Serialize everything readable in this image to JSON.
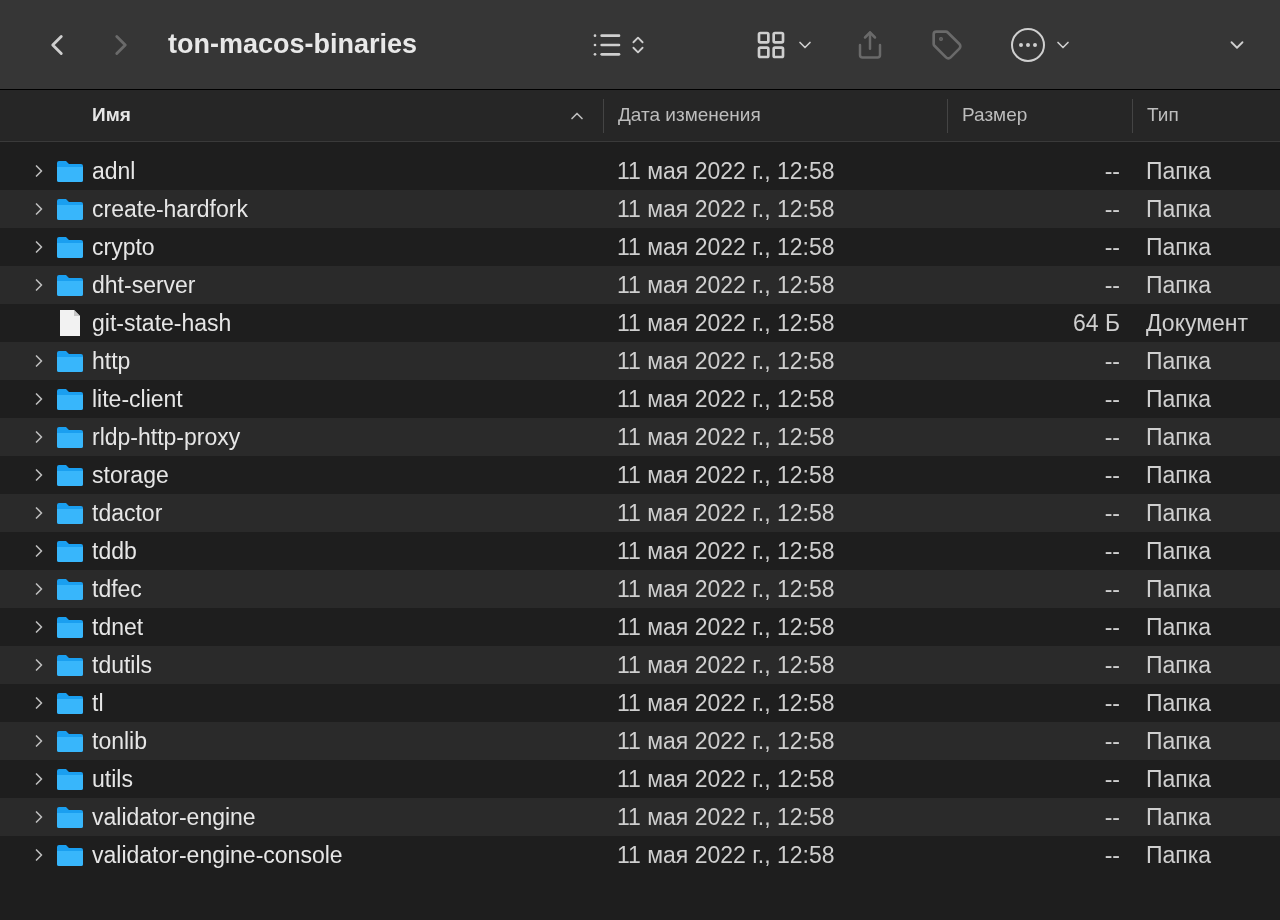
{
  "window": {
    "title": "ton-macos-binaries"
  },
  "columns": [
    {
      "label": "Имя",
      "sorted": true
    },
    {
      "label": "Дата изменения",
      "sorted": false
    },
    {
      "label": "Размер",
      "sorted": false
    },
    {
      "label": "Тип",
      "sorted": false
    }
  ],
  "rows": [
    {
      "kind": "folder",
      "name": "adnl",
      "date": "11 мая 2022 г., 12:58",
      "size": "--",
      "type": "Папка"
    },
    {
      "kind": "folder",
      "name": "create-hardfork",
      "date": "11 мая 2022 г., 12:58",
      "size": "--",
      "type": "Папка"
    },
    {
      "kind": "folder",
      "name": "crypto",
      "date": "11 мая 2022 г., 12:58",
      "size": "--",
      "type": "Папка"
    },
    {
      "kind": "folder",
      "name": "dht-server",
      "date": "11 мая 2022 г., 12:58",
      "size": "--",
      "type": "Папка"
    },
    {
      "kind": "file",
      "name": "git-state-hash",
      "date": "11 мая 2022 г., 12:58",
      "size": "64 Б",
      "type": "Документ"
    },
    {
      "kind": "folder",
      "name": "http",
      "date": "11 мая 2022 г., 12:58",
      "size": "--",
      "type": "Папка"
    },
    {
      "kind": "folder",
      "name": "lite-client",
      "date": "11 мая 2022 г., 12:58",
      "size": "--",
      "type": "Папка"
    },
    {
      "kind": "folder",
      "name": "rldp-http-proxy",
      "date": "11 мая 2022 г., 12:58",
      "size": "--",
      "type": "Папка"
    },
    {
      "kind": "folder",
      "name": "storage",
      "date": "11 мая 2022 г., 12:58",
      "size": "--",
      "type": "Папка"
    },
    {
      "kind": "folder",
      "name": "tdactor",
      "date": "11 мая 2022 г., 12:58",
      "size": "--",
      "type": "Папка"
    },
    {
      "kind": "folder",
      "name": "tddb",
      "date": "11 мая 2022 г., 12:58",
      "size": "--",
      "type": "Папка"
    },
    {
      "kind": "folder",
      "name": "tdfec",
      "date": "11 мая 2022 г., 12:58",
      "size": "--",
      "type": "Папка"
    },
    {
      "kind": "folder",
      "name": "tdnet",
      "date": "11 мая 2022 г., 12:58",
      "size": "--",
      "type": "Папка"
    },
    {
      "kind": "folder",
      "name": "tdutils",
      "date": "11 мая 2022 г., 12:58",
      "size": "--",
      "type": "Папка"
    },
    {
      "kind": "folder",
      "name": "tl",
      "date": "11 мая 2022 г., 12:58",
      "size": "--",
      "type": "Папка"
    },
    {
      "kind": "folder",
      "name": "tonlib",
      "date": "11 мая 2022 г., 12:58",
      "size": "--",
      "type": "Папка"
    },
    {
      "kind": "folder",
      "name": "utils",
      "date": "11 мая 2022 г., 12:58",
      "size": "--",
      "type": "Папка"
    },
    {
      "kind": "folder",
      "name": "validator-engine",
      "date": "11 мая 2022 г., 12:58",
      "size": "--",
      "type": "Папка"
    },
    {
      "kind": "folder",
      "name": "validator-engine-console",
      "date": "11 мая 2022 г., 12:58",
      "size": "--",
      "type": "Папка"
    }
  ]
}
